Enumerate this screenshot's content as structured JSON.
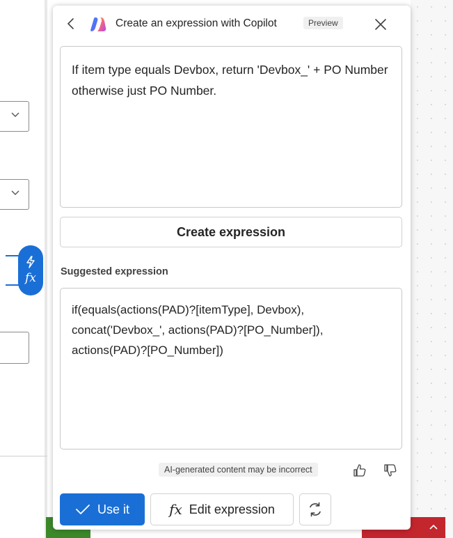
{
  "header": {
    "title": "Create an expression with Copilot",
    "badge": "Preview"
  },
  "prompt": {
    "text": "If item type equals Devbox, return 'Devbox_' + PO Number otherwise just PO Number."
  },
  "create_button_label": "Create expression",
  "suggested": {
    "label": "Suggested expression",
    "lines": [
      "if(equals(actions(PAD)?[itemType], Devbox),",
      "concat('Devbox_', actions(PAD)?[PO_Number]),",
      "actions(PAD)?[PO_Number])"
    ]
  },
  "disclaimer": "AI-generated content may be incorrect",
  "actions": {
    "use_label": "Use it",
    "edit_label": "Edit expression",
    "fx_glyph": "fx"
  },
  "icons": {
    "back": "chevron-left-icon",
    "copilot": "copilot-logo-icon",
    "close": "close-icon",
    "thumbs_up": "thumbs-up-icon",
    "thumbs_down": "thumbs-down-icon",
    "check": "checkmark-icon",
    "refresh": "refresh-icon",
    "lightning": "lightning-icon"
  },
  "colors": {
    "accent": "#1a6fd6",
    "border": "#c8c8c8",
    "badge_bg": "#f0f0f0",
    "green": "#3b8a2a",
    "red": "#c4262e"
  }
}
